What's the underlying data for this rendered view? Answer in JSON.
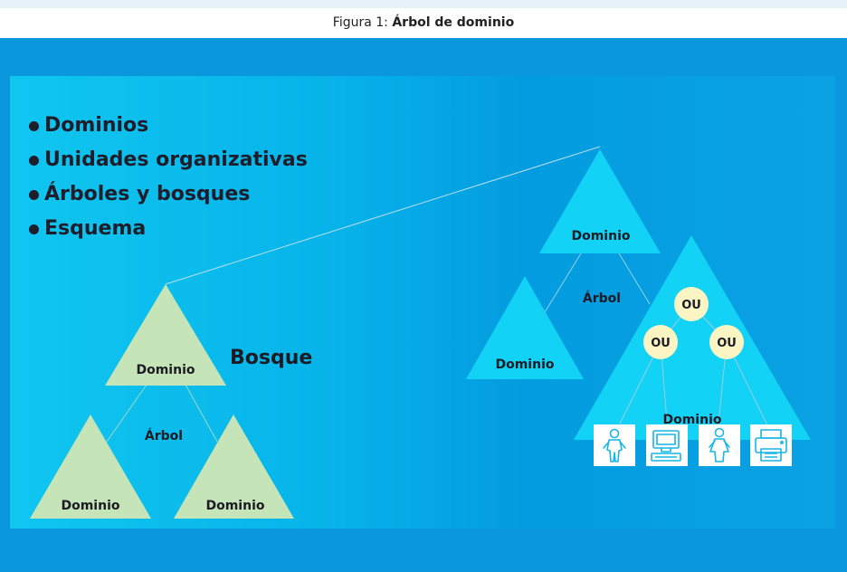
{
  "caption": {
    "prefix": "Figura 1: ",
    "title": "Árbol de dominio"
  },
  "bullets": [
    "Dominios",
    "Unidades organizativas",
    "Árboles y bosques",
    "Esquema"
  ],
  "forest_label": "Bosque",
  "left_tree": {
    "root": "Dominio",
    "label": "Árbol",
    "child_left": "Dominio",
    "child_right": "Dominio"
  },
  "right_tree": {
    "root": "Dominio",
    "label": "Árbol",
    "child_left": "Dominio",
    "child_big": "Dominio"
  },
  "ou_nodes": [
    "OU",
    "OU",
    "OU"
  ],
  "objects": [
    {
      "icon": "user-icon"
    },
    {
      "icon": "computer-icon"
    },
    {
      "icon": "user-female-icon"
    },
    {
      "icon": "printer-icon"
    }
  ],
  "colors": {
    "green_triangle": "#c5e4b7",
    "cyan_triangle": "#12d2f6",
    "ou_circle": "#fbf5c3",
    "background": "#0a97de"
  }
}
